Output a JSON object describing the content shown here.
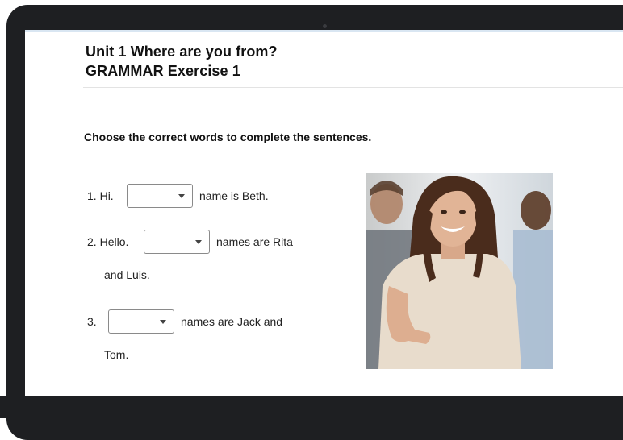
{
  "header": {
    "title": "Unit 1 Where are you from?",
    "subtitle": "GRAMMAR Exercise 1"
  },
  "instructions": "Choose the correct words to complete the sentences.",
  "questions": [
    {
      "number": "1.",
      "before": "Hi.",
      "after": "name is Beth.",
      "selected": ""
    },
    {
      "number": "2.",
      "before": "Hello.",
      "after": "names are Rita",
      "continuation": "and Luis.",
      "selected": ""
    },
    {
      "number": "3.",
      "before": "",
      "after": "names are Jack and",
      "continuation": "Tom.",
      "selected": ""
    }
  ],
  "photo": {
    "icon": "photo-smiling-woman-handshake"
  },
  "colors": {
    "bezel": "#1e1f22",
    "screen": "#ffffff",
    "text": "#111111"
  }
}
